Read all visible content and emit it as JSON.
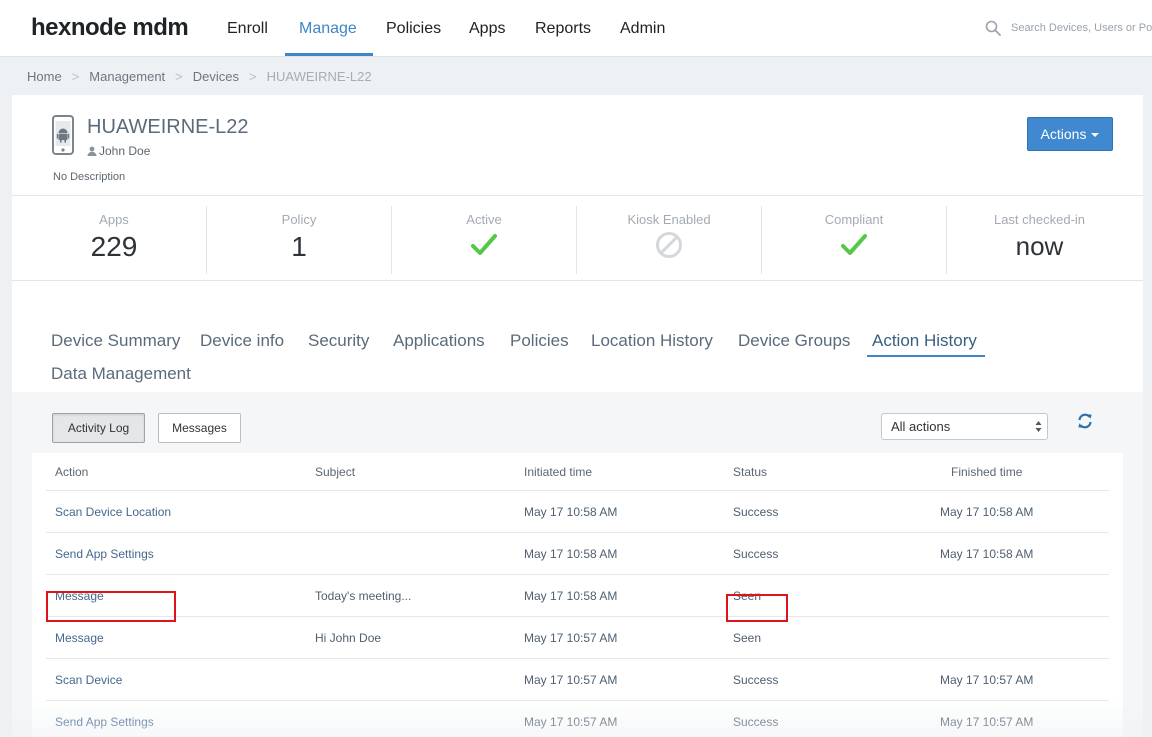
{
  "brand": {
    "logo": "hexnode mdm"
  },
  "nav": {
    "items": [
      {
        "label": "Enroll"
      },
      {
        "label": "Manage"
      },
      {
        "label": "Policies"
      },
      {
        "label": "Apps"
      },
      {
        "label": "Reports"
      },
      {
        "label": "Admin"
      }
    ],
    "active": "Manage",
    "search_placeholder": "Search Devices, Users or Po"
  },
  "breadcrumb": [
    "Home",
    "Management",
    "Devices",
    "HUAWEIRNE-L22"
  ],
  "device": {
    "name": "HUAWEIRNE-L22",
    "user": "John Doe",
    "description": "No Description",
    "actions_label": "Actions"
  },
  "stats": {
    "apps": {
      "label": "Apps",
      "value": "229"
    },
    "policy": {
      "label": "Policy",
      "value": "1"
    },
    "active": {
      "label": "Active"
    },
    "kiosk": {
      "label": "Kiosk Enabled"
    },
    "compliant": {
      "label": "Compliant"
    },
    "checked_in": {
      "label": "Last checked-in",
      "value": "now"
    }
  },
  "tabs": [
    "Device Summary",
    "Device info",
    "Security",
    "Applications",
    "Policies",
    "Location History",
    "Device Groups",
    "Action History",
    "Data Management"
  ],
  "active_tab": "Action History",
  "activity": {
    "buttons": {
      "activity_log": "Activity Log",
      "messages": "Messages"
    },
    "filter_value": "All actions",
    "columns": [
      "Action",
      "Subject",
      "Initiated time",
      "Status",
      "Finished time"
    ],
    "rows": [
      {
        "action": "Scan Device Location",
        "subject": "",
        "initiated": "May 17 10:58 AM",
        "status": "Success",
        "finished": "May 17 10:58 AM"
      },
      {
        "action": "Send App Settings",
        "subject": "",
        "initiated": "May 17 10:58 AM",
        "status": "Success",
        "finished": "May 17 10:58 AM"
      },
      {
        "action": "Message",
        "subject": "Today's meeting...",
        "initiated": "May 17 10:58 AM",
        "status": "Seen",
        "finished": ""
      },
      {
        "action": "Message",
        "subject": "Hi John Doe",
        "initiated": "May 17 10:57 AM",
        "status": "Seen",
        "finished": ""
      },
      {
        "action": "Scan Device",
        "subject": "",
        "initiated": "May 17 10:57 AM",
        "status": "Success",
        "finished": "May 17 10:57 AM"
      },
      {
        "action": "Send App Settings",
        "subject": "",
        "initiated": "May 17 10:57 AM",
        "status": "Success",
        "finished": "May 17 10:57 AM"
      }
    ]
  },
  "colors": {
    "accent": "#3e86c9",
    "check": "#55c847",
    "highlight": "#e0131a"
  }
}
